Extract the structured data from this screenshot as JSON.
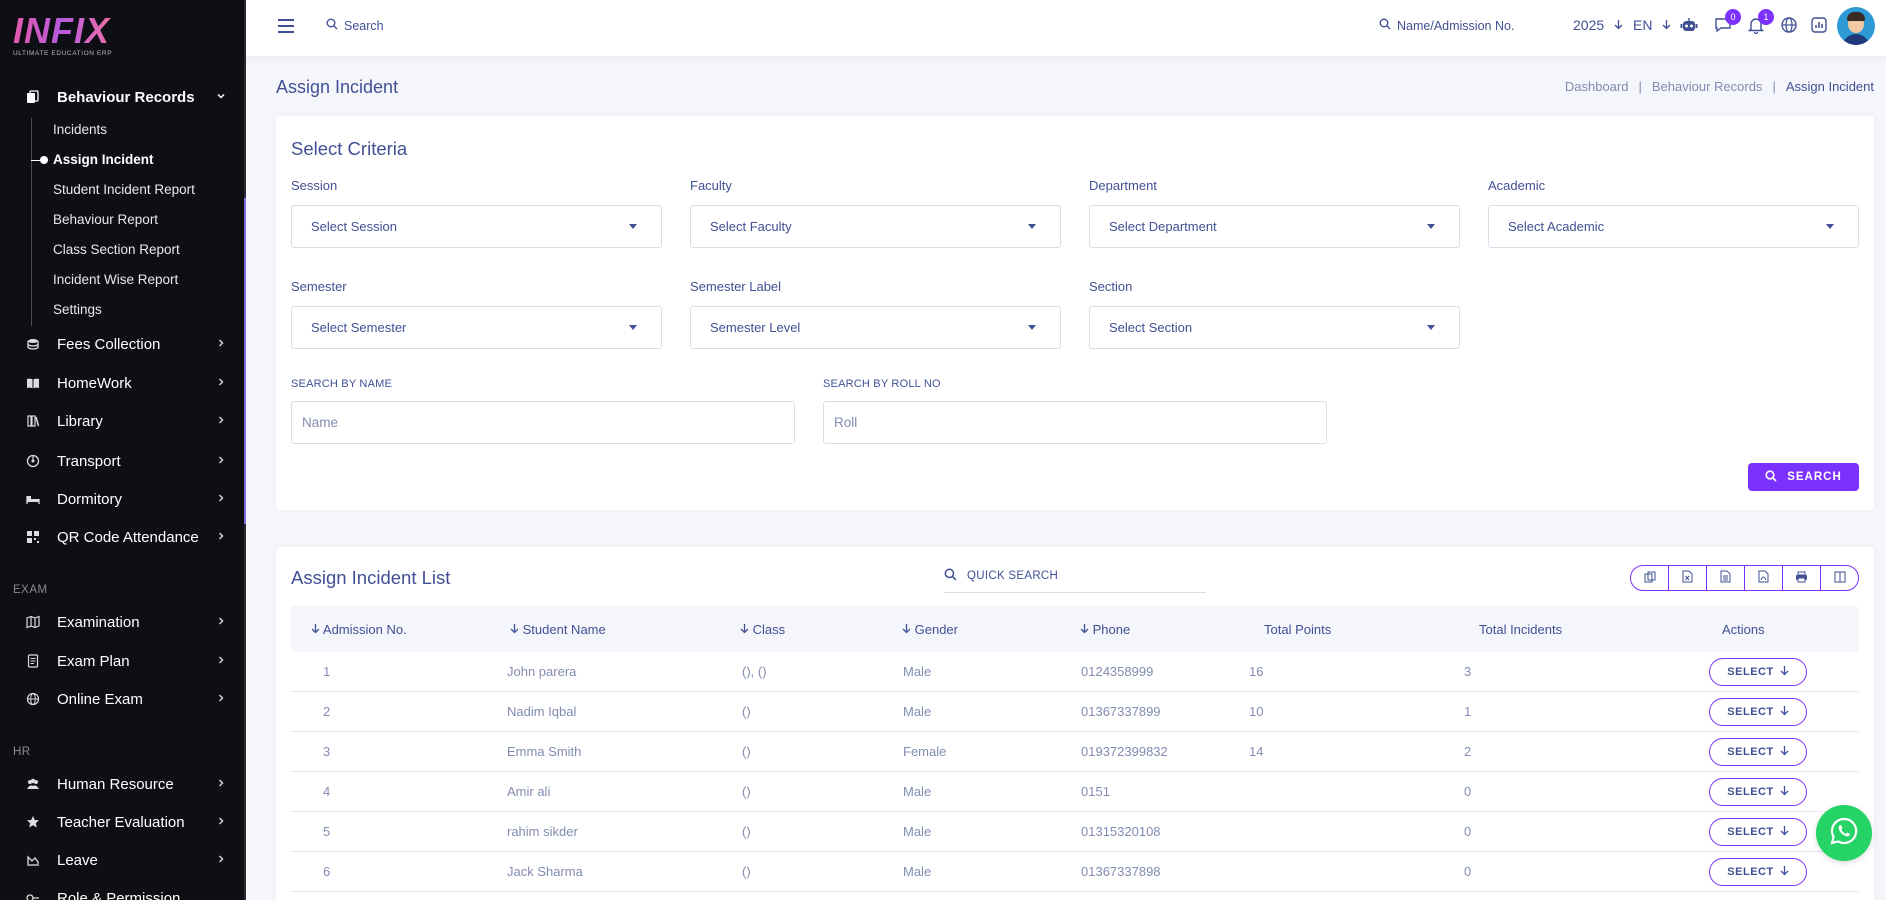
{
  "brand": {
    "name": "INFIX",
    "tagline": "ULTIMATE EDUCATION ERP"
  },
  "sidebar": {
    "active_group": {
      "label": "Behaviour Records",
      "icon": "file-stack-icon"
    },
    "sub_items": [
      "Incidents",
      "Assign Incident",
      "Student Incident Report",
      "Behaviour Report",
      "Class Section Report",
      "Incident Wise Report",
      "Settings"
    ],
    "groups_top": [
      {
        "label": "Fees Collection",
        "icon": "coins-icon"
      },
      {
        "label": "HomeWork",
        "icon": "book-icon"
      },
      {
        "label": "Library",
        "icon": "library-icon"
      },
      {
        "label": "Transport",
        "icon": "transport-icon"
      },
      {
        "label": "Dormitory",
        "icon": "bed-icon"
      },
      {
        "label": "QR Code Attendance",
        "icon": "qr-code-icon"
      }
    ],
    "section_exam": "EXAM",
    "groups_exam": [
      {
        "label": "Examination",
        "icon": "map-icon"
      },
      {
        "label": "Exam Plan",
        "icon": "document-icon"
      },
      {
        "label": "Online Exam",
        "icon": "globe-icon"
      }
    ],
    "section_hr": "HR",
    "groups_hr": [
      {
        "label": "Human Resource",
        "icon": "users-icon"
      },
      {
        "label": "Teacher Evaluation",
        "icon": "star-icon"
      },
      {
        "label": "Leave",
        "icon": "leave-icon"
      },
      {
        "label": "Role & Permission",
        "icon": "key-icon"
      }
    ]
  },
  "header": {
    "search_label": "Search",
    "admission_search_label": "Name/Admission No.",
    "year": "2025",
    "language": "EN",
    "messages_count": "0",
    "notifications_count": "1"
  },
  "page": {
    "title": "Assign Incident",
    "breadcrumb": [
      "Dashboard",
      "Behaviour Records",
      "Assign Incident"
    ]
  },
  "criteria": {
    "title": "Select Criteria",
    "fields": [
      {
        "label": "Session",
        "value": "Select Session"
      },
      {
        "label": "Faculty",
        "value": "Select Faculty"
      },
      {
        "label": "Department",
        "value": "Select Department"
      },
      {
        "label": "Academic",
        "value": "Select Academic"
      },
      {
        "label": "Semester",
        "value": "Select Semester"
      },
      {
        "label": "Semester Label",
        "value": "Semester Level"
      },
      {
        "label": "Section",
        "value": "Select Section"
      }
    ],
    "name_label": "SEARCH BY NAME",
    "name_placeholder": "Name",
    "roll_label": "SEARCH BY ROLL NO",
    "roll_placeholder": "Roll",
    "search_button": "SEARCH"
  },
  "list": {
    "title": "Assign Incident List",
    "quick_search": "QUICK SEARCH",
    "columns": [
      "Admission No.",
      "Student Name",
      "Class",
      "Gender",
      "Phone",
      "Total Points",
      "Total Incidents",
      "Actions"
    ],
    "action_label": "SELECT",
    "rows": [
      {
        "admission": "1",
        "name": "John parera",
        "class": "(), ()",
        "gender": "Male",
        "phone": "0124358999",
        "points": "16",
        "incidents": "3"
      },
      {
        "admission": "2",
        "name": "Nadim Iqbal",
        "class": "()",
        "gender": "Male",
        "phone": "01367337899",
        "points": "10",
        "incidents": "1"
      },
      {
        "admission": "3",
        "name": "Emma Smith",
        "class": "()",
        "gender": "Female",
        "phone": "019372399832",
        "points": "14",
        "incidents": "2"
      },
      {
        "admission": "4",
        "name": "Amir ali",
        "class": "()",
        "gender": "Male",
        "phone": "0151",
        "points": "",
        "incidents": "0"
      },
      {
        "admission": "5",
        "name": "rahim sikder",
        "class": "()",
        "gender": "Male",
        "phone": "01315320108",
        "points": "",
        "incidents": "0"
      },
      {
        "admission": "6",
        "name": "Jack Sharma",
        "class": "()",
        "gender": "Male",
        "phone": "01367337898",
        "points": "",
        "incidents": "0"
      }
    ]
  },
  "colors": {
    "primary": "#7c32ff",
    "text": "#415094",
    "muted": "#828bb2",
    "sidebar_bg": "#0e0e15",
    "whatsapp": "#25d366"
  }
}
